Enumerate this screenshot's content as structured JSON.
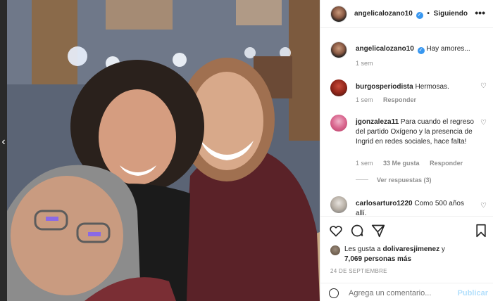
{
  "post": {
    "username": "angelicalozano10",
    "verified": true,
    "follow_label": "Siguiendo",
    "separator": "•",
    "more_label": "•••"
  },
  "caption": {
    "username": "angelicalozano10",
    "text": "Hay amores...",
    "time": "1 sem"
  },
  "comments": [
    {
      "username": "burgosperiodista",
      "text": "Hermosas.",
      "time": "1 sem",
      "reply_label": "Responder"
    },
    {
      "username": "jgonzaleza11",
      "text": "Para cuando el regreso del partido Oxígeno y la presencia de Ingrid en redes sociales, hace falta!",
      "time": "1 sem",
      "likes": "33 Me gusta",
      "reply_label": "Responder",
      "view_replies": "Ver respuestas (3)"
    },
    {
      "username": "carlosarturo1220",
      "text": "Como 500 años allí."
    }
  ],
  "likes": {
    "prefix": "Les gusta a",
    "user": "dolivaresjimenez",
    "conj": "y",
    "count": "7,069 personas más"
  },
  "date": "24 DE SEPTIEMBRE",
  "add_comment": {
    "placeholder": "Agrega un comentario...",
    "publish_label": "Publicar"
  },
  "icons": {
    "verified": "verified-badge-icon",
    "prev": "chevron-left-icon",
    "like": "heart-icon",
    "comment": "comment-icon",
    "share": "paper-plane-icon",
    "save": "bookmark-icon",
    "emoji": "smiley-icon"
  },
  "colors": {
    "verified": "#3897f0",
    "muted": "#8e8e8e",
    "publish_disabled": "#b2dffc"
  }
}
